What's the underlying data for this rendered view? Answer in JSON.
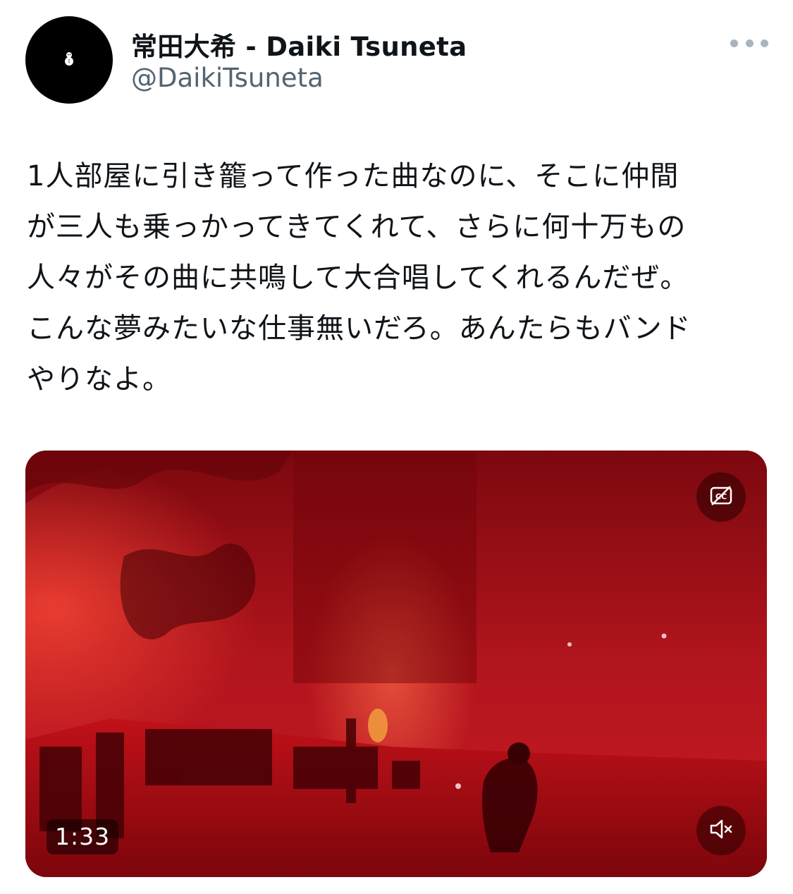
{
  "author": {
    "display_name": "常田大希 - Daiki Tsuneta",
    "handle": "@DaikiTsuneta",
    "avatar_icon": "snowman-icon"
  },
  "menu": {
    "icon": "more-horizontal-icon"
  },
  "tweet": {
    "lines": [
      "1人部屋に引き籠って作った曲なのに、そこに仲間",
      "が三人も乗っかってきてくれて、さらに何十万もの",
      "人々がその曲に共鳴して大合唱してくれるんだぜ。",
      "こんな夢みたいな仕事無いだろ。あんたらもバンド",
      "やりなよ。"
    ]
  },
  "video": {
    "duration": "1:33",
    "captions_icon": "captions-off-icon",
    "sound_icon": "volume-muted-icon",
    "colors": {
      "base": "#b3121a",
      "highlight": "#ff3a2e",
      "shadow": "#4a0306"
    }
  }
}
